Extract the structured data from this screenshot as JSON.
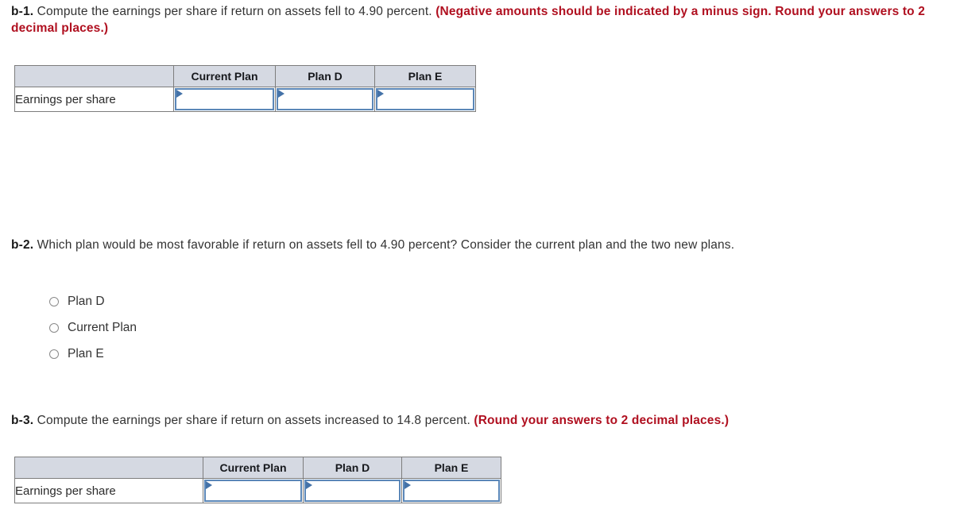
{
  "questions": {
    "b1": {
      "label": "b-1.",
      "text": " Compute the earnings per share if return on assets fell to 4.90 percent. ",
      "emphasis": "(Negative amounts should be indicated by a minus sign. Round your answers to 2 decimal places.)"
    },
    "b2": {
      "label": "b-2.",
      "text": " Which plan would be most favorable if return on assets fell to 4.90 percent? Consider the current plan and the two new plans."
    },
    "b3": {
      "label": "b-3.",
      "text": " Compute the earnings per share if return on assets increased to 14.8 percent. ",
      "emphasis": "(Round your answers to 2 decimal places.)"
    }
  },
  "table_b1": {
    "headers": [
      "",
      "Current Plan",
      "Plan D",
      "Plan E"
    ],
    "rows": [
      {
        "label": "Earnings per share",
        "values": [
          "",
          "",
          ""
        ]
      }
    ]
  },
  "table_b3": {
    "headers": [
      "",
      "Current Plan",
      "Plan D",
      "Plan E"
    ],
    "rows": [
      {
        "label": "Earnings per share",
        "values": [
          "",
          "",
          ""
        ]
      }
    ]
  },
  "radio_options": [
    {
      "label": "Plan D",
      "selected": false
    },
    {
      "label": "Current Plan",
      "selected": false
    },
    {
      "label": "Plan E",
      "selected": false
    }
  ],
  "colors": {
    "emphasis_red": "#b01020",
    "header_bg": "#d5d9e2",
    "input_border": "#5b87b8",
    "table_border": "#7d7d7d",
    "body_text": "#333333"
  }
}
